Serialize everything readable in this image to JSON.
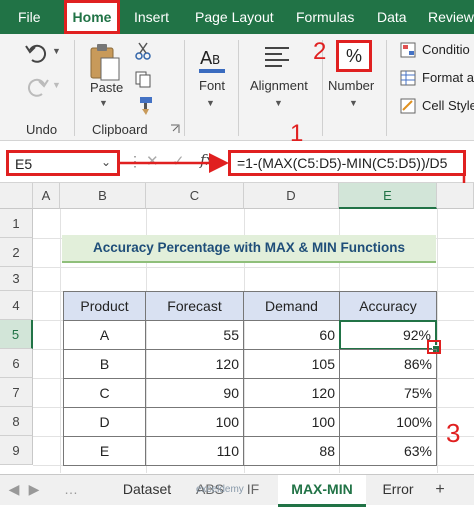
{
  "menu": {
    "file": "File",
    "home": "Home",
    "insert": "Insert",
    "page_layout": "Page Layout",
    "formulas": "Formulas",
    "data": "Data",
    "review": "Review"
  },
  "ribbon": {
    "undo_label": "Undo",
    "paste_label": "Paste",
    "clipboard_label": "Clipboard",
    "font_label": "Font",
    "alignment_label": "Alignment",
    "number_label": "Number",
    "percent_symbol": "%",
    "conditional_label": "Conditio",
    "format_as_label": "Format a",
    "cell_styles_label": "Cell Style"
  },
  "formula_bar": {
    "name_box": "E5",
    "fx": "fx",
    "formula": "=1-(MAX(C5:D5)-MIN(C5:D5))/D5"
  },
  "annotations": {
    "step1": "1",
    "step2": "2",
    "step3": "3"
  },
  "sheet": {
    "columns": [
      "A",
      "B",
      "C",
      "D",
      "E"
    ],
    "rows": [
      "1",
      "2",
      "3",
      "4",
      "5",
      "6",
      "7",
      "8",
      "9"
    ],
    "title": "Accuracy Percentage with MAX & MIN Functions",
    "headers": [
      "Product",
      "Forecast",
      "Demand",
      "Accuracy"
    ],
    "data": [
      [
        "A",
        "55",
        "60",
        "92%"
      ],
      [
        "B",
        "120",
        "105",
        "86%"
      ],
      [
        "C",
        "90",
        "120",
        "75%"
      ],
      [
        "D",
        "100",
        "100",
        "100%"
      ],
      [
        "E",
        "110",
        "88",
        "63%"
      ]
    ]
  },
  "tabs": [
    "Dataset",
    "ABS",
    "IF",
    "MAX-MIN",
    "Error"
  ],
  "watermark": "exceldemy",
  "colors": {
    "excel_green": "#217346",
    "annotation_red": "#e02020",
    "title_fill": "#e2efda",
    "title_text": "#1f4e79",
    "header_fill": "#d9e1f2"
  }
}
